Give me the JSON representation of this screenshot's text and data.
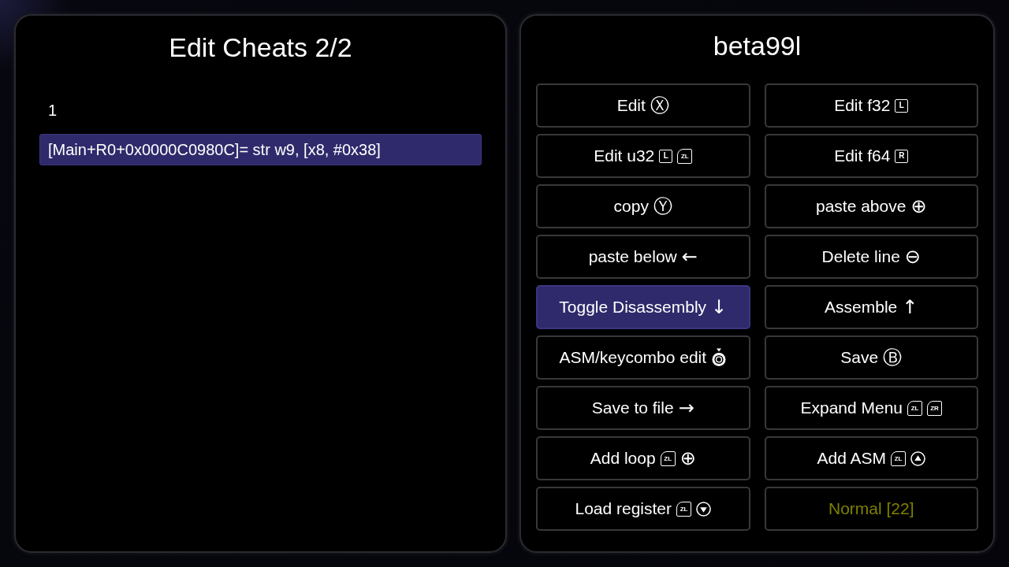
{
  "left_panel": {
    "title": "Edit Cheats 2/2",
    "lines": [
      {
        "text": "1",
        "selected": false
      },
      {
        "text": "[Main+R0+0x0000C0980C]= str w9, [x8, #0x38]",
        "selected": true
      }
    ]
  },
  "right_panel": {
    "title": "beta99l",
    "buttons": [
      {
        "kind": "action",
        "label": "Edit",
        "selected": false,
        "keys": [
          {
            "kind": "glyph",
            "text": "Ⓧ"
          }
        ]
      },
      {
        "kind": "action",
        "label": "Edit f32",
        "selected": false,
        "keys": [
          {
            "kind": "key",
            "text": "L"
          }
        ]
      },
      {
        "kind": "action",
        "label": "Edit u32",
        "selected": false,
        "keys": [
          {
            "kind": "key",
            "text": "L"
          },
          {
            "kind": "trigger",
            "text": "ZL"
          }
        ]
      },
      {
        "kind": "action",
        "label": "Edit f64",
        "selected": false,
        "keys": [
          {
            "kind": "key",
            "text": "R"
          }
        ]
      },
      {
        "kind": "action",
        "label": "copy",
        "selected": false,
        "keys": [
          {
            "kind": "glyph",
            "text": "Ⓨ"
          }
        ]
      },
      {
        "kind": "action",
        "label": "paste above",
        "selected": false,
        "keys": [
          {
            "kind": "glyph",
            "text": "⊕"
          }
        ]
      },
      {
        "kind": "action",
        "label": "paste below",
        "selected": false,
        "keys": [
          {
            "kind": "glyph",
            "text": "←"
          }
        ]
      },
      {
        "kind": "action",
        "label": "Delete line",
        "selected": false,
        "keys": [
          {
            "kind": "glyph",
            "text": "⊖"
          }
        ]
      },
      {
        "kind": "action",
        "label": "Toggle Disassembly",
        "selected": true,
        "keys": [
          {
            "kind": "glyph",
            "text": "↓"
          }
        ]
      },
      {
        "kind": "action",
        "label": "Assemble",
        "selected": false,
        "keys": [
          {
            "kind": "glyph",
            "text": "↑"
          }
        ]
      },
      {
        "kind": "action",
        "label": "ASM/keycombo edit",
        "selected": false,
        "keys": [
          {
            "kind": "stick"
          }
        ]
      },
      {
        "kind": "action",
        "label": "Save",
        "selected": false,
        "keys": [
          {
            "kind": "glyph",
            "text": "Ⓑ"
          }
        ]
      },
      {
        "kind": "action",
        "label": "Save to file",
        "selected": false,
        "keys": [
          {
            "kind": "glyph",
            "text": "→"
          }
        ]
      },
      {
        "kind": "action",
        "label": "Expand Menu",
        "selected": false,
        "keys": [
          {
            "kind": "trigger",
            "text": "ZL"
          },
          {
            "kind": "trigger",
            "text": "ZR"
          }
        ]
      },
      {
        "kind": "action",
        "label": "Add loop",
        "selected": false,
        "keys": [
          {
            "kind": "trigger",
            "text": "ZL"
          },
          {
            "kind": "glyph",
            "text": "⊕"
          }
        ]
      },
      {
        "kind": "action",
        "label": "Add ASM",
        "selected": false,
        "keys": [
          {
            "kind": "trigger",
            "text": "ZL"
          },
          {
            "kind": "triangle-up"
          }
        ]
      },
      {
        "kind": "action",
        "label": "Load register",
        "selected": false,
        "keys": [
          {
            "kind": "trigger",
            "text": "ZL"
          },
          {
            "kind": "triangle-down"
          }
        ]
      },
      {
        "kind": "status",
        "label": "Normal [22]",
        "selected": false
      }
    ]
  }
}
